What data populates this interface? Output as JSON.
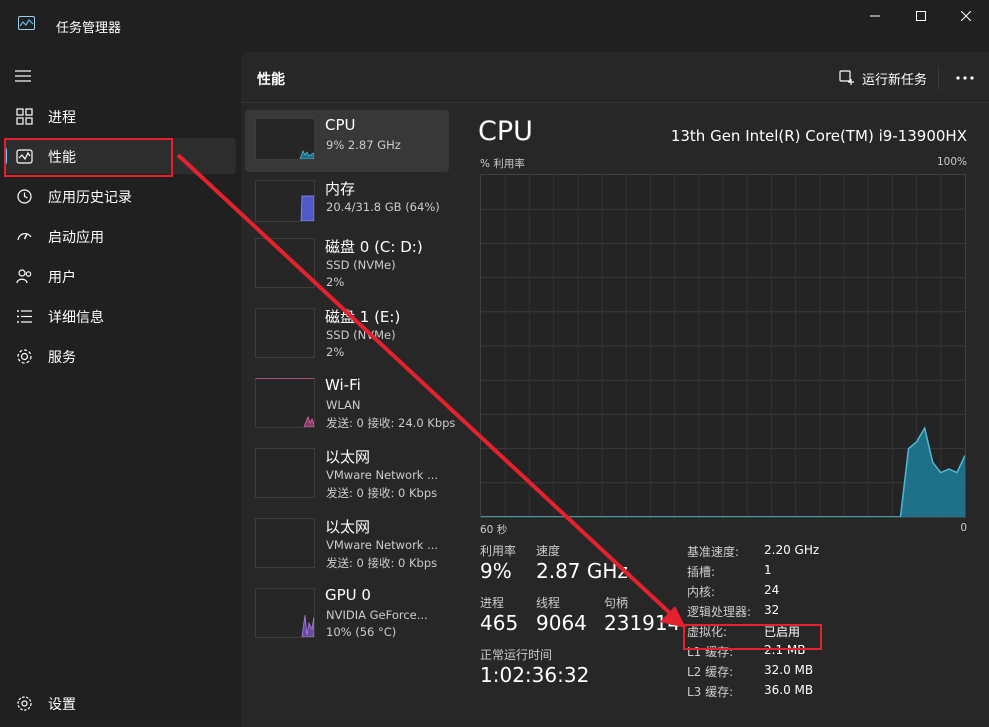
{
  "window": {
    "title": "任务管理器"
  },
  "sidebar": {
    "items": [
      {
        "label": "进程",
        "icon": "processes-icon"
      },
      {
        "label": "性能",
        "icon": "performance-icon",
        "active": true
      },
      {
        "label": "应用历史记录",
        "icon": "history-icon"
      },
      {
        "label": "启动应用",
        "icon": "startup-icon"
      },
      {
        "label": "用户",
        "icon": "users-icon"
      },
      {
        "label": "详细信息",
        "icon": "details-icon"
      },
      {
        "label": "服务",
        "icon": "services-icon"
      }
    ],
    "settings_label": "设置"
  },
  "header": {
    "title": "性能",
    "run_new_task": "运行新任务"
  },
  "resources": [
    {
      "name": "CPU",
      "sub1": "9% 2.87 GHz",
      "sub2": "",
      "color": "#4fb8d3",
      "active": true
    },
    {
      "name": "内存",
      "sub1": "20.4/31.8 GB (64%)",
      "sub2": "",
      "color": "#7c84e0"
    },
    {
      "name": "磁盘 0 (C: D:)",
      "sub1": "SSD (NVMe)",
      "sub2": "2%",
      "color": "#6cc04a"
    },
    {
      "name": "磁盘 1 (E:)",
      "sub1": "SSD (NVMe)",
      "sub2": "2%",
      "color": "#6cc04a"
    },
    {
      "name": "Wi-Fi",
      "sub1": "WLAN",
      "sub2": "发送: 0 接收: 24.0 Kbps",
      "color": "#e06ca8"
    },
    {
      "name": "以太网",
      "sub1": "VMware Network ...",
      "sub2": "发送: 0 接收: 0 Kbps",
      "color": "#e06ca8"
    },
    {
      "name": "以太网",
      "sub1": "VMware Network ...",
      "sub2": "发送: 0 接收: 0 Kbps",
      "color": "#e06ca8"
    },
    {
      "name": "GPU 0",
      "sub1": "NVIDIA GeForce...",
      "sub2": "10% (56 °C)",
      "color": "#a982dc"
    }
  ],
  "detail": {
    "title": "CPU",
    "model": "13th Gen Intel(R) Core(TM) i9-13900HX",
    "util_label": "% 利用率",
    "util_max": "100%",
    "time_label": "60 秒",
    "zero_label": "0",
    "stats": {
      "utilization_label": "利用率",
      "utilization": "9%",
      "speed_label": "速度",
      "speed": "2.87 GHz",
      "processes_label": "进程",
      "processes": "465",
      "threads_label": "线程",
      "threads": "9064",
      "handles_label": "句柄",
      "handles": "231914",
      "uptime_label": "正常运行时间",
      "uptime": "1:02:36:32"
    },
    "specs": [
      {
        "k": "基准速度:",
        "v": "2.20 GHz"
      },
      {
        "k": "插槽:",
        "v": "1"
      },
      {
        "k": "内核:",
        "v": "24"
      },
      {
        "k": "逻辑处理器:",
        "v": "32"
      },
      {
        "k": "虚拟化:",
        "v": "已启用"
      },
      {
        "k": "L1 缓存:",
        "v": "2.1 MB"
      },
      {
        "k": "L2 缓存:",
        "v": "32.0 MB"
      },
      {
        "k": "L3 缓存:",
        "v": "36.0 MB"
      }
    ]
  },
  "chart_data": {
    "type": "area",
    "ylabel": "% 利用率",
    "ylim": [
      0,
      100
    ],
    "xlim": [
      60,
      0
    ],
    "x": [
      60,
      8,
      7,
      6,
      5,
      4,
      3,
      2,
      1,
      0
    ],
    "series": [
      {
        "values": [
          0,
          0,
          20,
          22,
          26,
          16,
          13,
          14,
          13,
          18
        ]
      }
    ],
    "grid": true
  },
  "colors": {
    "accent": "#60cdff",
    "cpu": "#4fb8d3",
    "annotation": "#e4222e"
  }
}
